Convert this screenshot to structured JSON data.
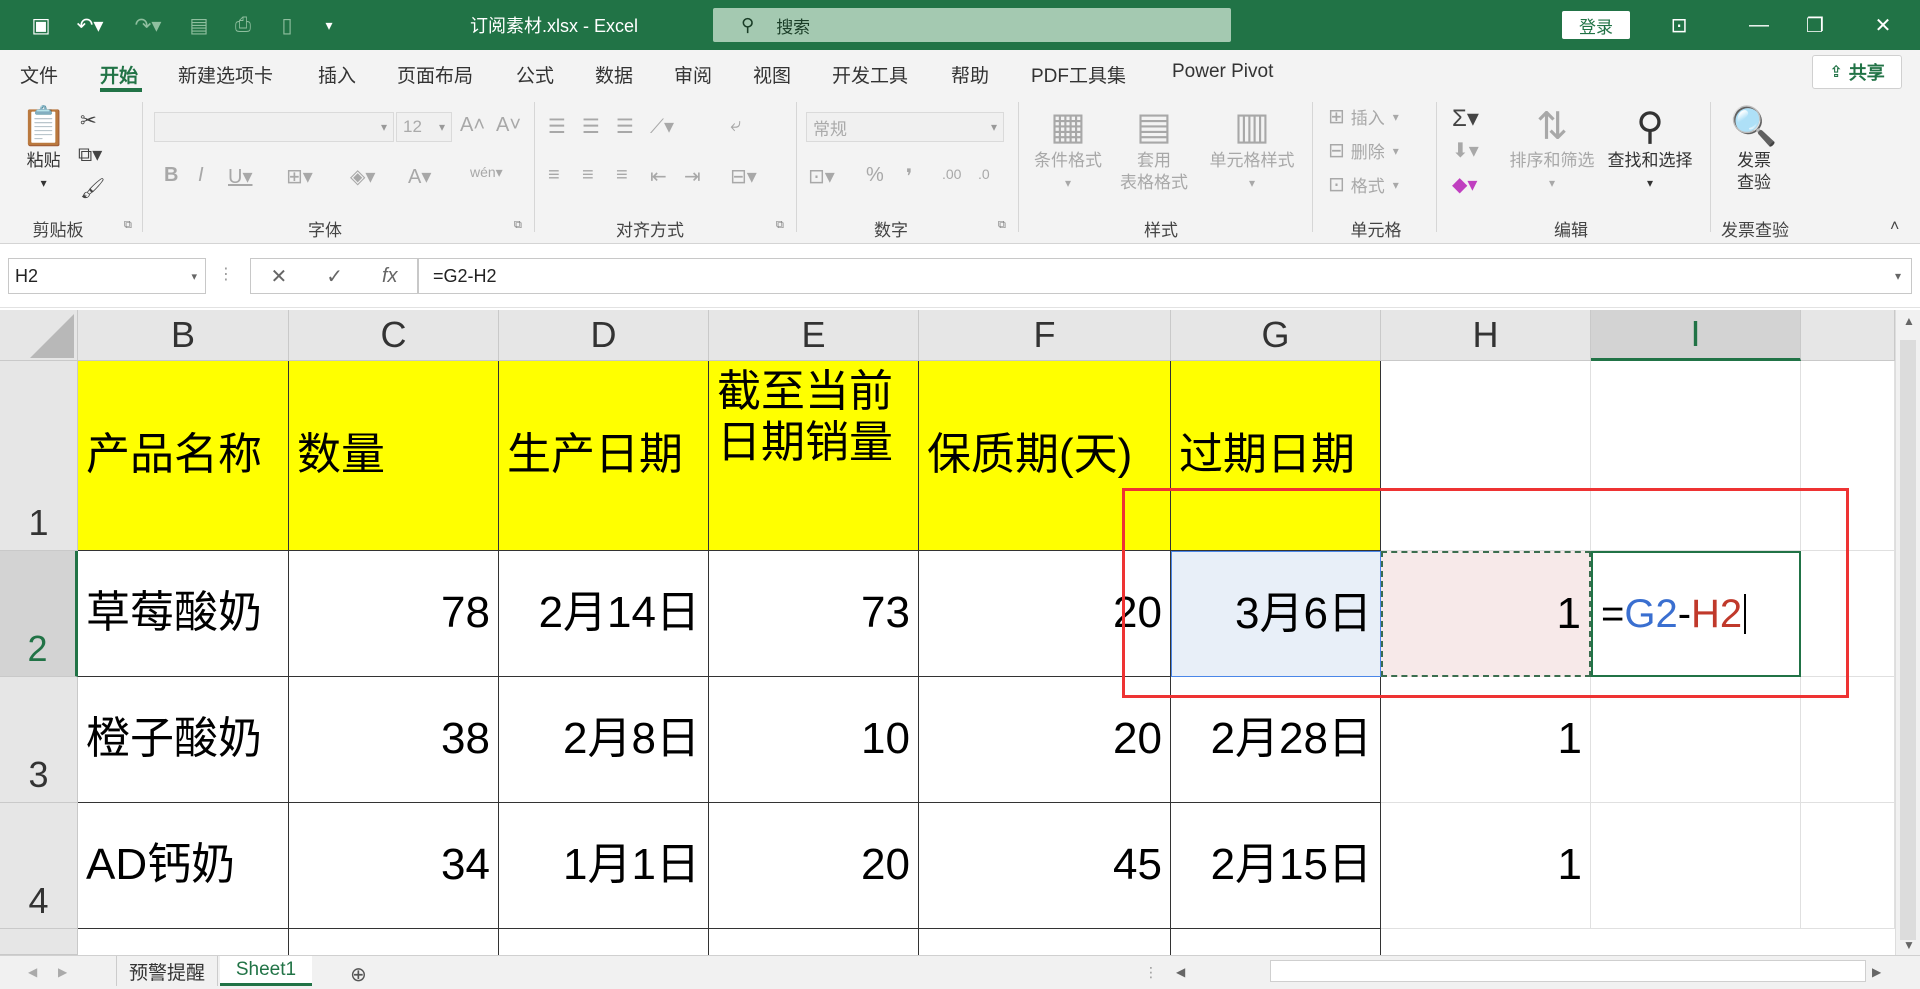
{
  "window": {
    "title": "订阅素材.xlsx  -  Excel",
    "search_placeholder": "搜索",
    "login_label": "登录",
    "share_label": "共享"
  },
  "menu": {
    "tabs": [
      "文件",
      "开始",
      "新建选项卡",
      "插入",
      "页面布局",
      "公式",
      "数据",
      "审阅",
      "视图",
      "开发工具",
      "帮助",
      "PDF工具集",
      "Power Pivot"
    ],
    "active_tab": "开始"
  },
  "ribbon": {
    "paste_label": "粘贴",
    "font_name": "",
    "font_size": "12",
    "number_format": "常规",
    "conditional_format": "条件格式",
    "table_format_1": "套用",
    "table_format_2": "表格格式",
    "cell_styles": "单元格样式",
    "insert": "插入",
    "delete": "删除",
    "format": "格式",
    "sort_filter": "排序和筛选",
    "find_select": "查找和选择",
    "invoice_1": "发票",
    "invoice_2": "查验",
    "groups": {
      "clipboard": "剪贴板",
      "font": "字体",
      "alignment": "对齐方式",
      "number": "数字",
      "styles": "样式",
      "cells": "单元格",
      "editing": "编辑",
      "invoice": "发票查验"
    }
  },
  "formula_bar": {
    "name_box": "H2",
    "formula": "=G2-H2"
  },
  "grid": {
    "columns": [
      "B",
      "C",
      "D",
      "E",
      "F",
      "G",
      "H",
      "I"
    ],
    "active_column": "I",
    "rows": [
      "1",
      "2",
      "3",
      "4"
    ],
    "active_row": "2",
    "header_row": [
      "产品名称",
      "数量",
      "生产日期",
      "截至当前日期销量",
      "保质期(天)",
      "过期日期"
    ],
    "data_rows": [
      [
        "草莓酸奶",
        "78",
        "2月14日",
        "73",
        "20",
        "3月6日",
        "1"
      ],
      [
        "橙子酸奶",
        "38",
        "2月8日",
        "10",
        "20",
        "2月28日",
        "1"
      ],
      [
        "AD钙奶",
        "34",
        "1月1日",
        "20",
        "45",
        "2月15日",
        "1"
      ]
    ],
    "editing_cell": {
      "eq": "=",
      "ref1": "G2",
      "op": "-",
      "ref2": "H2"
    }
  },
  "sheets": {
    "tabs": [
      "预警提醒",
      "Sheet1"
    ],
    "active": "Sheet1"
  },
  "colors": {
    "excel_green": "#217346",
    "header_fill": "#ffff00",
    "annotation_red": "#e33333"
  }
}
